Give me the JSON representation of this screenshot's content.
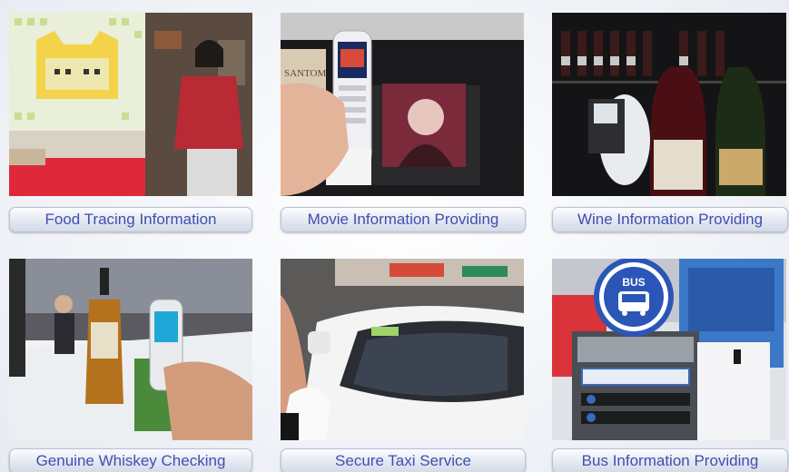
{
  "captions": {
    "food": "Food Tracing Information",
    "movie": "Movie Information Providing",
    "wine": "Wine Information Providing",
    "whiskey": "Genuine Whiskey Checking",
    "taxi": "Secure Taxi Service",
    "bus": "Bus Information Providing"
  },
  "photos": {
    "bus_sign_text": "BUS",
    "movie_poster_text": "SANTOM"
  },
  "colors": {
    "caption_text": "#3f4fb0",
    "bus_sign_blue": "#2b56b8"
  }
}
